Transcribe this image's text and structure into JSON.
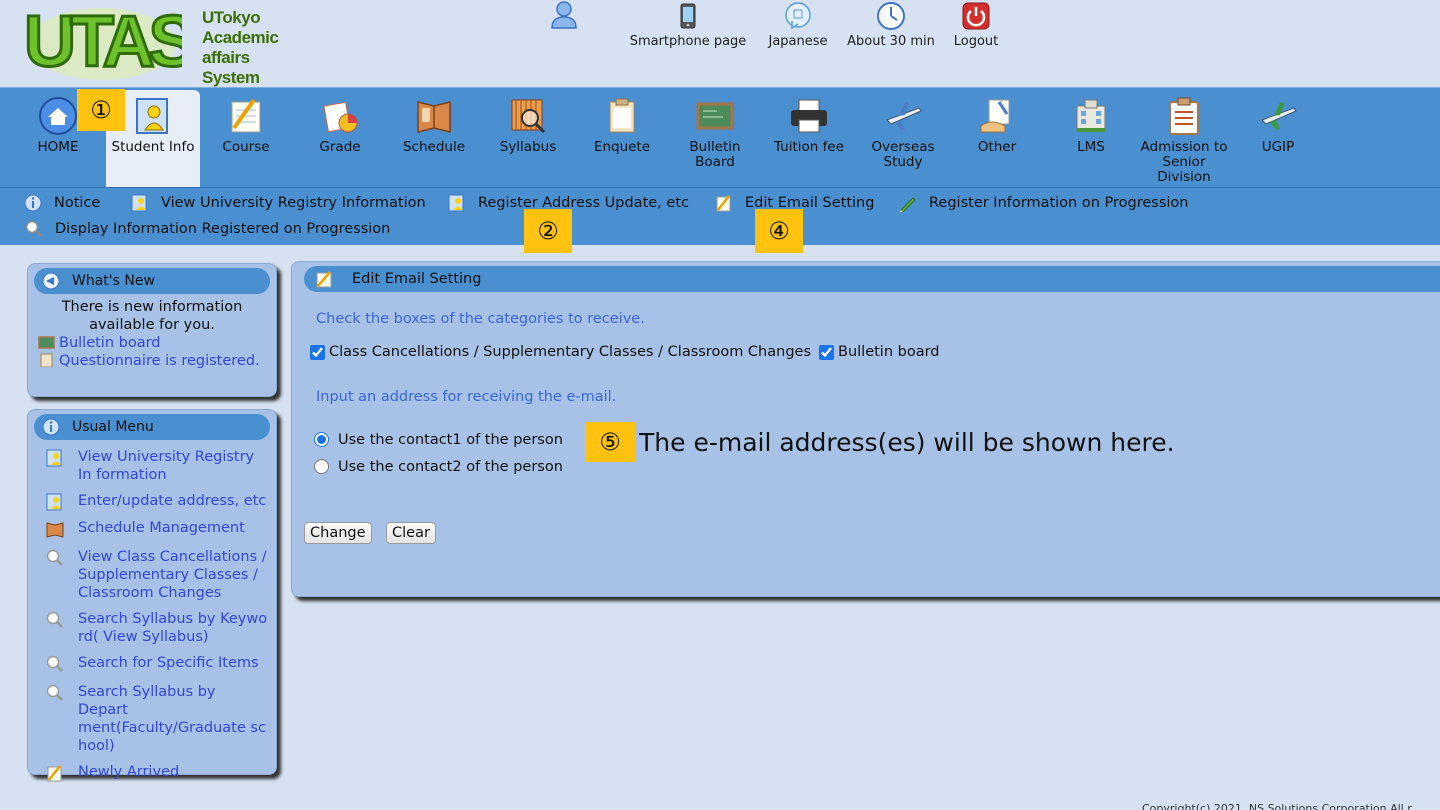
{
  "header": {
    "logo_text": [
      "UTokyo",
      "Academic affairs",
      "System"
    ],
    "top_links": [
      {
        "label": "",
        "icon": "user-icon"
      },
      {
        "label": "Smartphone page",
        "icon": "smartphone-icon"
      },
      {
        "label": "Japanese",
        "icon": "language-icon"
      },
      {
        "label": "About 30 min",
        "icon": "clock-icon"
      },
      {
        "label": "Logout",
        "icon": "power-icon"
      }
    ]
  },
  "nav": {
    "items": [
      {
        "label": "HOME",
        "icon": "home-icon"
      },
      {
        "label": "Student Info",
        "icon": "student-info-icon"
      },
      {
        "label": "Course",
        "icon": "course-icon"
      },
      {
        "label": "Grade",
        "icon": "grade-icon"
      },
      {
        "label": "Schedule",
        "icon": "schedule-icon"
      },
      {
        "label": "Syllabus",
        "icon": "syllabus-icon"
      },
      {
        "label": "Enquete",
        "icon": "enquete-icon"
      },
      {
        "label": "Bulletin Board",
        "icon": "bulletin-board-icon"
      },
      {
        "label": "Tuition fee",
        "icon": "printer-icon"
      },
      {
        "label": "Overseas Study",
        "icon": "airplane-icon"
      },
      {
        "label": "Other",
        "icon": "other-icon"
      },
      {
        "label": "LMS",
        "icon": "building-icon"
      },
      {
        "label": "Admission to Senior Division",
        "icon": "clipboard-icon"
      },
      {
        "label": "UGIP",
        "icon": "airplane-icon"
      }
    ],
    "active": "Student Info"
  },
  "subnav": {
    "items": [
      {
        "label": "Notice",
        "icon": "info-icon"
      },
      {
        "label": "View University Registry Information",
        "icon": "registry-icon"
      },
      {
        "label": "Register Address Update, etc",
        "icon": "registry-icon"
      },
      {
        "label": "Edit Email Setting",
        "icon": "pen-icon"
      },
      {
        "label": "Register Information on Progression",
        "icon": "pencil-icon"
      },
      {
        "label": "Display Information Registered on Progression",
        "icon": "magnifier-icon"
      }
    ]
  },
  "markers": {
    "m1": "①",
    "m2": "②",
    "m4": "④",
    "m5": "⑤"
  },
  "whats_new": {
    "title": "What's New",
    "message": "There is new information available for you.",
    "links": [
      "Bulletin board",
      "Questionnaire is registered."
    ]
  },
  "usual_menu": {
    "title": "Usual Menu",
    "items": [
      "View University Registry In formation",
      "Enter/update address, etc",
      "Schedule Management",
      "View Class Cancellations / Supplementary Classes / Classroom Changes",
      "Search Syllabus by Keywo rd( View Syllabus)",
      "Search for Specific Items",
      "Search Syllabus by Depart ment(Faculty/Graduate sc hool)",
      "Newly Arrived"
    ]
  },
  "content": {
    "title": "Edit Email Setting",
    "help_label": "?",
    "instruction_categories": "Check the boxes of the categories to receive.",
    "checkboxes": [
      {
        "label": "Class Cancellations / Supplementary Classes / Classroom Changes",
        "checked": true
      },
      {
        "label": "Bulletin board",
        "checked": true
      }
    ],
    "instruction_address": "Input an address for receiving the e-mail.",
    "radios": [
      {
        "label": "Use the contact1 of the person",
        "checked": true
      },
      {
        "label": "Use the contact2 of the person",
        "checked": false
      }
    ],
    "email_note": "The e-mail address(es) will be shown here.",
    "change_button": "Change",
    "clear_button": "Clear"
  },
  "footer": {
    "copyright": "Copyright(c) 2021, NS Solutions Corporation All r"
  },
  "colors": {
    "nav_blue": "#4a90d1",
    "panel_blue": "#a7c2e6",
    "link_blue": "#3346d6",
    "marker_yellow": "#ffc20e"
  }
}
